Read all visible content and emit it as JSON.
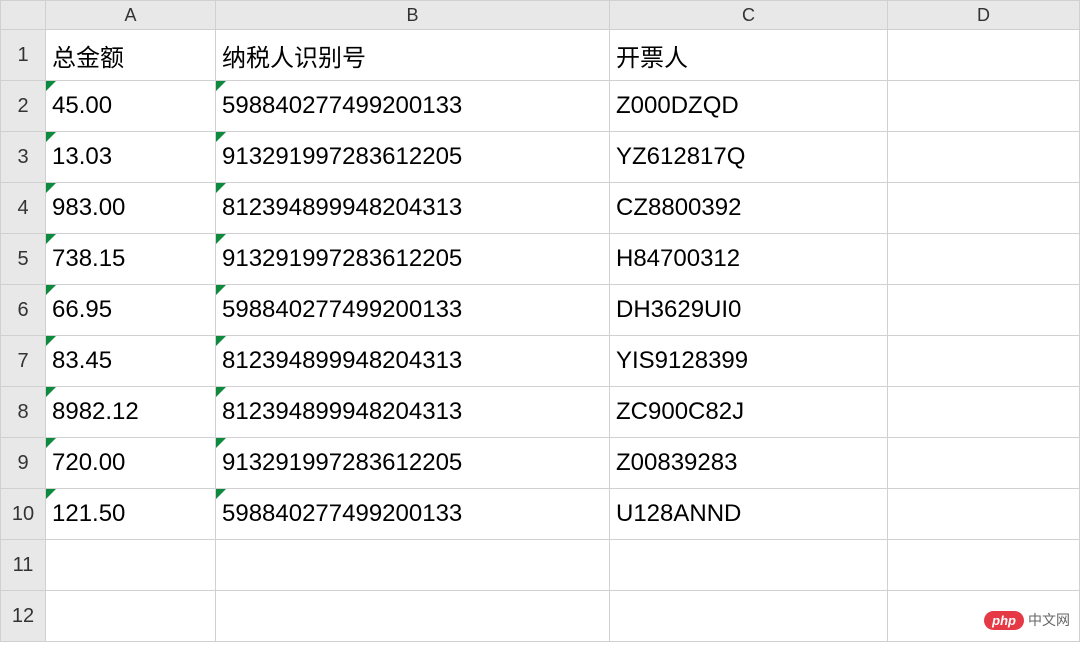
{
  "columns": [
    "A",
    "B",
    "C",
    "D"
  ],
  "headers": {
    "A": "总金额",
    "B": "纳税人识别号",
    "C": "开票人",
    "D": ""
  },
  "rows": [
    {
      "n": "1"
    },
    {
      "n": "2",
      "A": "45.00",
      "B": "598840277499200133",
      "C": "Z000DZQD"
    },
    {
      "n": "3",
      "A": "13.03",
      "B": "913291997283612205",
      "C": "YZ612817Q"
    },
    {
      "n": "4",
      "A": "983.00",
      "B": "812394899948204313",
      "C": "CZ8800392"
    },
    {
      "n": "5",
      "A": "738.15",
      "B": "913291997283612205",
      "C": "H84700312"
    },
    {
      "n": "6",
      "A": "66.95",
      "B": "598840277499200133",
      "C": "DH3629UI0"
    },
    {
      "n": "7",
      "A": "83.45",
      "B": "812394899948204313",
      "C": "YIS9128399"
    },
    {
      "n": "8",
      "A": "8982.12",
      "B": "812394899948204313",
      "C": "ZC900C82J"
    },
    {
      "n": "9",
      "A": "720.00",
      "B": "913291997283612205",
      "C": "Z00839283"
    },
    {
      "n": "10",
      "A": "121.50",
      "B": "598840277499200133",
      "C": "U128ANND"
    },
    {
      "n": "11"
    },
    {
      "n": "12"
    }
  ],
  "watermark": {
    "badge": "php",
    "text": "中文网"
  },
  "chart_data": {
    "type": "table",
    "columns": [
      "总金额",
      "纳税人识别号",
      "开票人"
    ],
    "data": [
      [
        "45.00",
        "598840277499200133",
        "Z000DZQD"
      ],
      [
        "13.03",
        "913291997283612205",
        "YZ612817Q"
      ],
      [
        "983.00",
        "812394899948204313",
        "CZ8800392"
      ],
      [
        "738.15",
        "913291997283612205",
        "H84700312"
      ],
      [
        "66.95",
        "598840277499200133",
        "DH3629UI0"
      ],
      [
        "83.45",
        "812394899948204313",
        "YIS9128399"
      ],
      [
        "8982.12",
        "812394899948204313",
        "ZC900C82J"
      ],
      [
        "720.00",
        "913291997283612205",
        "Z00839283"
      ],
      [
        "121.50",
        "598840277499200133",
        "U128ANND"
      ]
    ]
  }
}
